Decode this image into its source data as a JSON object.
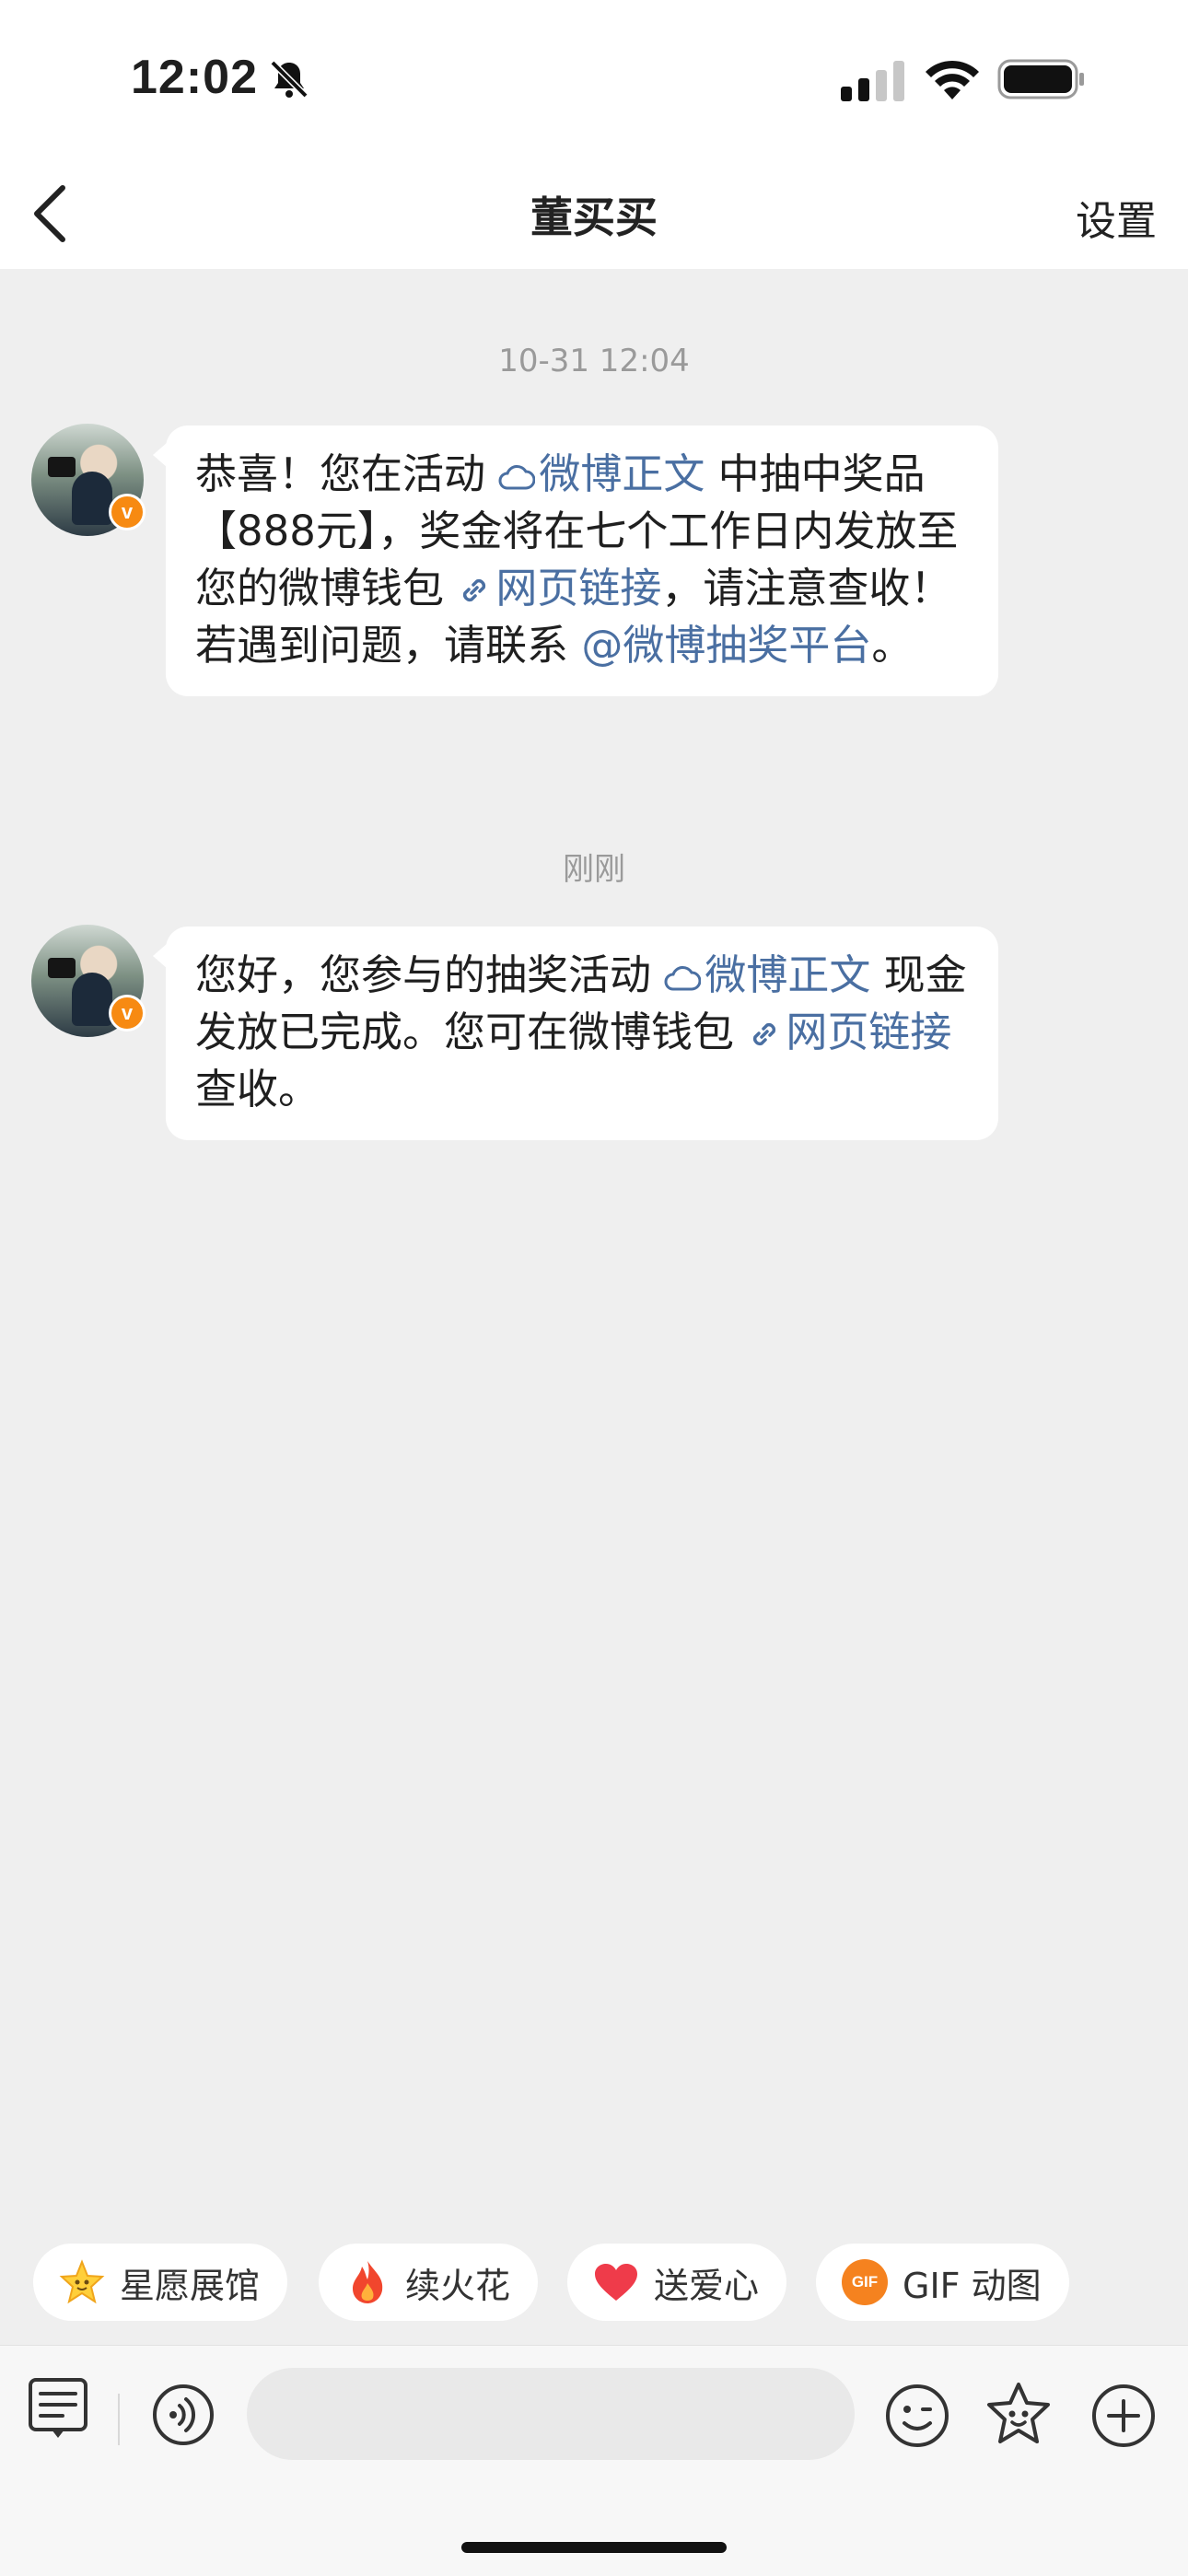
{
  "status_bar": {
    "time": "12:02",
    "icons": [
      "bell-muted-icon",
      "signal-icon",
      "wifi-icon",
      "battery-icon"
    ]
  },
  "nav": {
    "title": "董买买",
    "settings_label": "设置",
    "back_icon": "chevron-left-icon"
  },
  "messages": [
    {
      "timestamp": "10-31 12:04",
      "segments": [
        {
          "text": "恭喜！您在活动 ",
          "link": false
        },
        {
          "text": "微博正文",
          "link": true,
          "icon": "weibo-cloud-icon"
        },
        {
          "text": " 中抽中奖品【888元】，奖金将在七个工作日内发放至您的微博钱包 ",
          "link": false
        },
        {
          "text": "网页链接",
          "link": true,
          "icon": "link-icon"
        },
        {
          "text": "，请注意查收！若遇到问题，请联系 ",
          "link": false
        },
        {
          "text": "@微博抽奖平台",
          "link": true
        },
        {
          "text": "。",
          "link": false
        }
      ]
    },
    {
      "timestamp": "刚刚",
      "segments": [
        {
          "text": "您好，您参与的抽奖活动 ",
          "link": false
        },
        {
          "text": "微博正文",
          "link": true,
          "icon": "weibo-cloud-icon"
        },
        {
          "text": " 现金发放已完成。您可在微博钱包 ",
          "link": false
        },
        {
          "text": "网页链接",
          "link": true,
          "icon": "link-icon"
        },
        {
          "text": " 查收。",
          "link": false
        }
      ]
    }
  ],
  "quick_chips": [
    {
      "label": "星愿展馆",
      "icon": "star-face-icon"
    },
    {
      "label": "续火花",
      "icon": "flame-icon"
    },
    {
      "label": "送爱心",
      "icon": "heart-icon"
    },
    {
      "label": "GIF 动图",
      "icon": "gif-icon",
      "icon_text": "GIF"
    }
  ],
  "input_bar": {
    "placeholder": "",
    "icons": [
      "keyboard-menu-icon",
      "voice-icon",
      "emoji-icon",
      "sticker-icon",
      "plus-icon"
    ]
  },
  "colors": {
    "link": "#4a6fa2",
    "background": "#efefef",
    "badge": "#f78a12"
  }
}
